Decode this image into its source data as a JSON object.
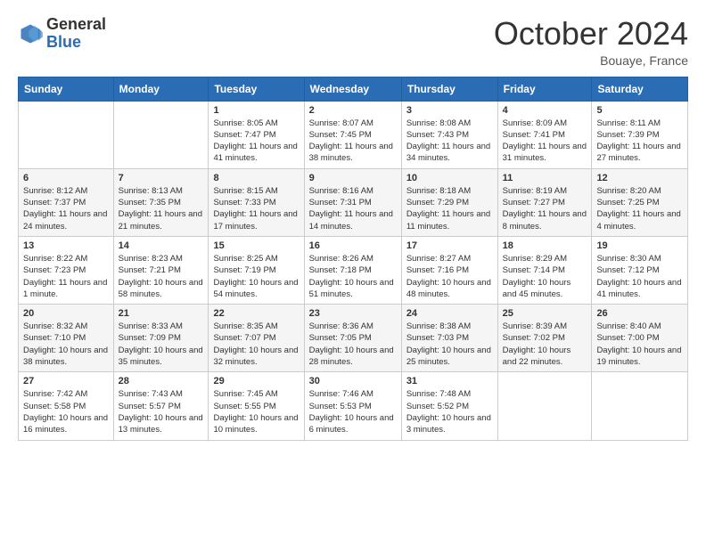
{
  "header": {
    "logo_general": "General",
    "logo_blue": "Blue",
    "month_title": "October 2024",
    "location": "Bouaye, France"
  },
  "days_of_week": [
    "Sunday",
    "Monday",
    "Tuesday",
    "Wednesday",
    "Thursday",
    "Friday",
    "Saturday"
  ],
  "weeks": [
    [
      {
        "day": "",
        "info": ""
      },
      {
        "day": "",
        "info": ""
      },
      {
        "day": "1",
        "info": "Sunrise: 8:05 AM\nSunset: 7:47 PM\nDaylight: 11 hours and 41 minutes."
      },
      {
        "day": "2",
        "info": "Sunrise: 8:07 AM\nSunset: 7:45 PM\nDaylight: 11 hours and 38 minutes."
      },
      {
        "day": "3",
        "info": "Sunrise: 8:08 AM\nSunset: 7:43 PM\nDaylight: 11 hours and 34 minutes."
      },
      {
        "day": "4",
        "info": "Sunrise: 8:09 AM\nSunset: 7:41 PM\nDaylight: 11 hours and 31 minutes."
      },
      {
        "day": "5",
        "info": "Sunrise: 8:11 AM\nSunset: 7:39 PM\nDaylight: 11 hours and 27 minutes."
      }
    ],
    [
      {
        "day": "6",
        "info": "Sunrise: 8:12 AM\nSunset: 7:37 PM\nDaylight: 11 hours and 24 minutes."
      },
      {
        "day": "7",
        "info": "Sunrise: 8:13 AM\nSunset: 7:35 PM\nDaylight: 11 hours and 21 minutes."
      },
      {
        "day": "8",
        "info": "Sunrise: 8:15 AM\nSunset: 7:33 PM\nDaylight: 11 hours and 17 minutes."
      },
      {
        "day": "9",
        "info": "Sunrise: 8:16 AM\nSunset: 7:31 PM\nDaylight: 11 hours and 14 minutes."
      },
      {
        "day": "10",
        "info": "Sunrise: 8:18 AM\nSunset: 7:29 PM\nDaylight: 11 hours and 11 minutes."
      },
      {
        "day": "11",
        "info": "Sunrise: 8:19 AM\nSunset: 7:27 PM\nDaylight: 11 hours and 8 minutes."
      },
      {
        "day": "12",
        "info": "Sunrise: 8:20 AM\nSunset: 7:25 PM\nDaylight: 11 hours and 4 minutes."
      }
    ],
    [
      {
        "day": "13",
        "info": "Sunrise: 8:22 AM\nSunset: 7:23 PM\nDaylight: 11 hours and 1 minute."
      },
      {
        "day": "14",
        "info": "Sunrise: 8:23 AM\nSunset: 7:21 PM\nDaylight: 10 hours and 58 minutes."
      },
      {
        "day": "15",
        "info": "Sunrise: 8:25 AM\nSunset: 7:19 PM\nDaylight: 10 hours and 54 minutes."
      },
      {
        "day": "16",
        "info": "Sunrise: 8:26 AM\nSunset: 7:18 PM\nDaylight: 10 hours and 51 minutes."
      },
      {
        "day": "17",
        "info": "Sunrise: 8:27 AM\nSunset: 7:16 PM\nDaylight: 10 hours and 48 minutes."
      },
      {
        "day": "18",
        "info": "Sunrise: 8:29 AM\nSunset: 7:14 PM\nDaylight: 10 hours and 45 minutes."
      },
      {
        "day": "19",
        "info": "Sunrise: 8:30 AM\nSunset: 7:12 PM\nDaylight: 10 hours and 41 minutes."
      }
    ],
    [
      {
        "day": "20",
        "info": "Sunrise: 8:32 AM\nSunset: 7:10 PM\nDaylight: 10 hours and 38 minutes."
      },
      {
        "day": "21",
        "info": "Sunrise: 8:33 AM\nSunset: 7:09 PM\nDaylight: 10 hours and 35 minutes."
      },
      {
        "day": "22",
        "info": "Sunrise: 8:35 AM\nSunset: 7:07 PM\nDaylight: 10 hours and 32 minutes."
      },
      {
        "day": "23",
        "info": "Sunrise: 8:36 AM\nSunset: 7:05 PM\nDaylight: 10 hours and 28 minutes."
      },
      {
        "day": "24",
        "info": "Sunrise: 8:38 AM\nSunset: 7:03 PM\nDaylight: 10 hours and 25 minutes."
      },
      {
        "day": "25",
        "info": "Sunrise: 8:39 AM\nSunset: 7:02 PM\nDaylight: 10 hours and 22 minutes."
      },
      {
        "day": "26",
        "info": "Sunrise: 8:40 AM\nSunset: 7:00 PM\nDaylight: 10 hours and 19 minutes."
      }
    ],
    [
      {
        "day": "27",
        "info": "Sunrise: 7:42 AM\nSunset: 5:58 PM\nDaylight: 10 hours and 16 minutes."
      },
      {
        "day": "28",
        "info": "Sunrise: 7:43 AM\nSunset: 5:57 PM\nDaylight: 10 hours and 13 minutes."
      },
      {
        "day": "29",
        "info": "Sunrise: 7:45 AM\nSunset: 5:55 PM\nDaylight: 10 hours and 10 minutes."
      },
      {
        "day": "30",
        "info": "Sunrise: 7:46 AM\nSunset: 5:53 PM\nDaylight: 10 hours and 6 minutes."
      },
      {
        "day": "31",
        "info": "Sunrise: 7:48 AM\nSunset: 5:52 PM\nDaylight: 10 hours and 3 minutes."
      },
      {
        "day": "",
        "info": ""
      },
      {
        "day": "",
        "info": ""
      }
    ]
  ]
}
